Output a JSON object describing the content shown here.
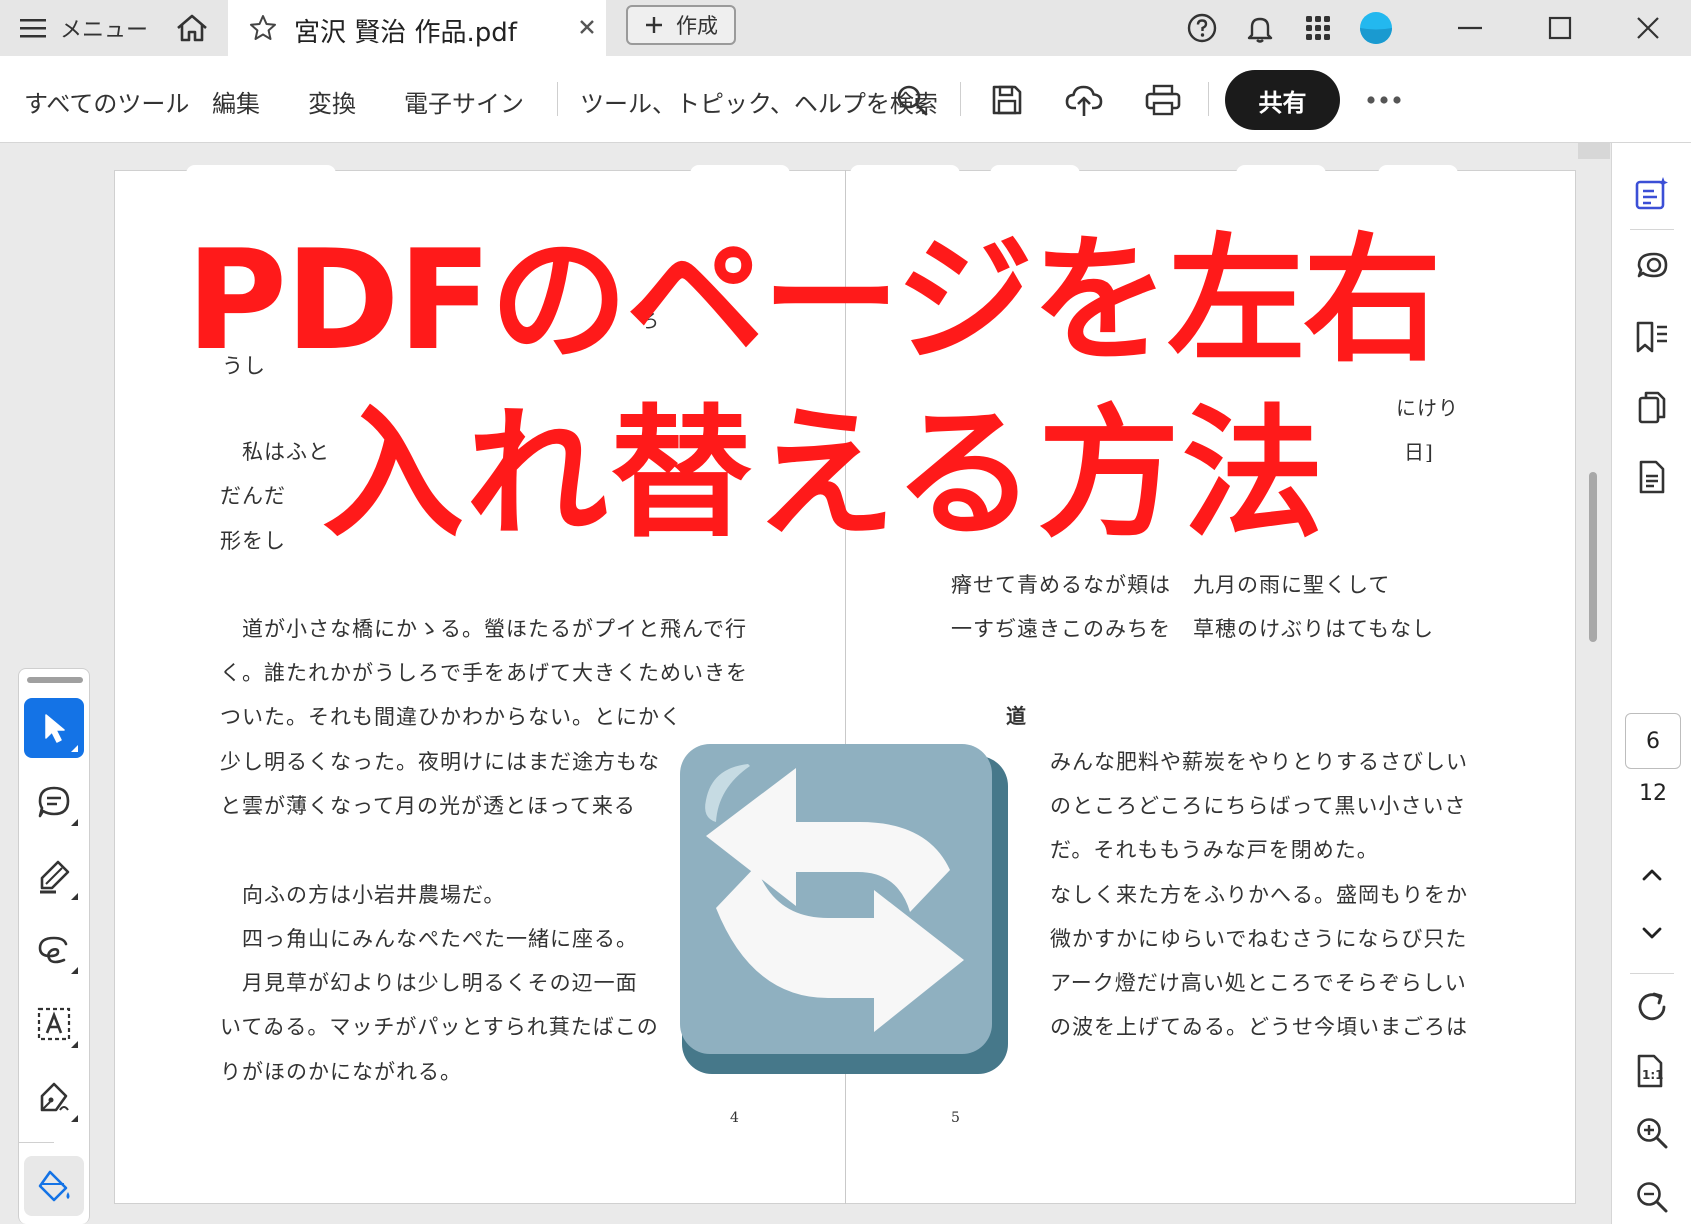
{
  "titlebar": {
    "menu_label": "メニュー",
    "tab_title": "宮沢 賢治 作品.pdf",
    "create_label": "作成"
  },
  "toolbar": {
    "nav": [
      "すべてのツール",
      "編集",
      "変換",
      "電子サイン"
    ],
    "search_label": "ツール、トピック、ヘルプを検索",
    "share_label": "共有"
  },
  "overlay": {
    "title_line1": "PDFのページを左右",
    "title_line2": "入れ替える方法"
  },
  "left_page": {
    "fragments": [
      "ろ",
      "うし",
      "私はふと",
      "だんだ",
      "形をし"
    ],
    "paragraph1": [
      "道が小さな橋にかゝる。螢ほたるがプイと飛んで行",
      "く。誰たれかがうしろで手をあげて大きくためいきを",
      "ついた。それも間違ひかわからない。とにかく",
      "少し明るくなった。夜明けにはまだ途方もな",
      "と雲が薄くなって月の光が透とほって来る"
    ],
    "paragraph2": [
      "向ふの方は小岩井農場だ。",
      "四っ角山にみんなぺたぺた一緒に座る。",
      "月見草が幻よりは少し明るくその辺一面",
      "いてゐる。マッチがパッとすられ萁たばこの",
      "りがほのかにながれる。"
    ],
    "page_number": "4"
  },
  "right_page": {
    "fragments": [
      "にけり",
      "日]"
    ],
    "poem": [
      "瘠せて青めるなが頬は　九月の雨に聖くして",
      "一すぢ遠きこのみちを　草穂のけぶりはてもなし"
    ],
    "heading": "道",
    "paragraph": [
      "みんな肥料や薪炭をやりとりするさびしい",
      "のところどころにちらばって黒い小さいさ",
      "だ。それももうみな戸を閉めた。",
      "なしく来た方をふりかへる。盛岡もりをか",
      "微かすかにゆらいでねむさうにならび只た",
      "アーク燈だけ高い処ところでそらぞらしい",
      "の波を上げてゐる。どうせ今頃いまごろは"
    ],
    "page_number": "5"
  },
  "sidebar": {
    "current_page": "6",
    "total_pages": "12"
  },
  "colors": {
    "accent": "#1473e6",
    "title_red": "#ff1a1a",
    "swap_icon_bg": "#8fb0c0",
    "swap_icon_shadow": "#46788a"
  }
}
